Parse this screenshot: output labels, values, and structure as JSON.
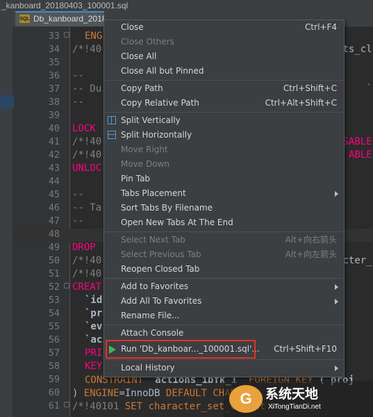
{
  "window": {
    "title_fragment": "_kanboard_20180403_100001.sql"
  },
  "tab": {
    "icon_label": "SQL",
    "label": "Db_kanboard_2018"
  },
  "editor": {
    "line_numbers": [
      "33",
      "34",
      "35",
      "36",
      "37",
      "38",
      "39",
      "40",
      "41",
      "42",
      "43",
      "44",
      "45",
      "46",
      "47",
      "48",
      "49",
      "50",
      "51",
      "52",
      "53",
      "54",
      "55",
      "56",
      "57",
      "58",
      "59",
      "60",
      "61"
    ],
    "code_lines": [
      {
        "a": "ENG",
        "b": ""
      },
      {
        "a": "/*!40",
        "b": "ts_cl"
      },
      {
        "a": "",
        "b": ""
      },
      {
        "a": "--",
        "b": ""
      },
      {
        "a": "-- Du",
        "b": "`"
      },
      {
        "a": "--",
        "b": ""
      },
      {
        "a": "",
        "b": ""
      },
      {
        "a": "LOCK",
        "b": ""
      },
      {
        "a": "/*!40",
        "b": "SABLE"
      },
      {
        "a": "/*!40",
        "b": "ABLE"
      },
      {
        "a": "UNLOC",
        "b": ""
      },
      {
        "a": "",
        "b": ""
      },
      {
        "a": "--",
        "b": ""
      },
      {
        "a": "-- Ta",
        "b": ""
      },
      {
        "a": "--",
        "b": ""
      },
      {
        "a": "",
        "b": ""
      },
      {
        "a": "DROP",
        "b": ""
      },
      {
        "a": "/*!40",
        "b": "cter_"
      },
      {
        "a": "/*!40",
        "b": ""
      },
      {
        "a": "CREAT",
        "b": ""
      },
      {
        "a": "`id",
        "b": ""
      },
      {
        "a": "`pr",
        "b": ""
      },
      {
        "a": "`ev",
        "b": ""
      },
      {
        "a": "`ac",
        "b": ""
      },
      {
        "a": "PRI",
        "b": ""
      },
      {
        "a": "KEY",
        "b": ""
      }
    ],
    "line_59": {
      "kw1": "CONSTRAINT",
      "name": "`actions_ibfk_1`",
      "kw2": "FOREIGN KEY",
      "rest": "(`proj"
    },
    "line_60": {
      "paren": ")",
      "kw1": "ENGINE",
      "eq": "=InnoDB",
      "kw2": "DEFAULT",
      "rest": "CHARS"
    },
    "line_61": {
      "cmt": "/*!40101",
      "kw": "SET",
      "rest": "character_set_client ="
    }
  },
  "context_menu": {
    "items": [
      {
        "label": "Close",
        "shortcut": "Ctrl+F4",
        "enabled": true
      },
      {
        "label": "Close Others",
        "shortcut": "",
        "enabled": false
      },
      {
        "label": "Close All",
        "shortcut": "",
        "enabled": true
      },
      {
        "label": "Close All but Pinned",
        "shortcut": "",
        "enabled": true
      },
      {
        "label": "Copy Path",
        "shortcut": "Ctrl+Shift+C",
        "enabled": true
      },
      {
        "label": "Copy Relative Path",
        "shortcut": "Ctrl+Alt+Shift+C",
        "enabled": true
      },
      {
        "label": "Split Vertically",
        "shortcut": "",
        "enabled": true
      },
      {
        "label": "Split Horizontally",
        "shortcut": "",
        "enabled": true
      },
      {
        "label": "Move Right",
        "shortcut": "",
        "enabled": false
      },
      {
        "label": "Move Down",
        "shortcut": "",
        "enabled": false
      },
      {
        "label": "Pin Tab",
        "shortcut": "",
        "enabled": true
      },
      {
        "label": "Tabs Placement",
        "shortcut": "",
        "enabled": true
      },
      {
        "label": "Sort Tabs By Filename",
        "shortcut": "",
        "enabled": true
      },
      {
        "label": "Open New Tabs At The End",
        "shortcut": "",
        "enabled": true
      },
      {
        "label": "Select Next Tab",
        "shortcut": "Alt+向右箭头",
        "enabled": false
      },
      {
        "label": "Select Previous Tab",
        "shortcut": "Alt+向左箭头",
        "enabled": false
      },
      {
        "label": "Reopen Closed Tab",
        "shortcut": "",
        "enabled": true
      },
      {
        "label": "Add to Favorites",
        "shortcut": "",
        "enabled": true
      },
      {
        "label": "Add All To Favorites",
        "shortcut": "",
        "enabled": true
      },
      {
        "label": "Rename File...",
        "shortcut": "",
        "enabled": true
      },
      {
        "label": "Attach Console",
        "shortcut": "",
        "enabled": true
      },
      {
        "label": "Run 'Db_kanboar..._100001.sql'...",
        "shortcut": "Ctrl+Shift+F10",
        "enabled": true
      },
      {
        "label": "Local History",
        "shortcut": "",
        "enabled": true
      }
    ]
  },
  "watermark": {
    "logo": "G",
    "title": "系统天地",
    "subtitle": "XiTongTianDi.net"
  },
  "colors": {
    "accent": "#4a88c7",
    "keyword": "#cc7832",
    "highlight": "#e4322b",
    "run_green": "#4caf50"
  }
}
